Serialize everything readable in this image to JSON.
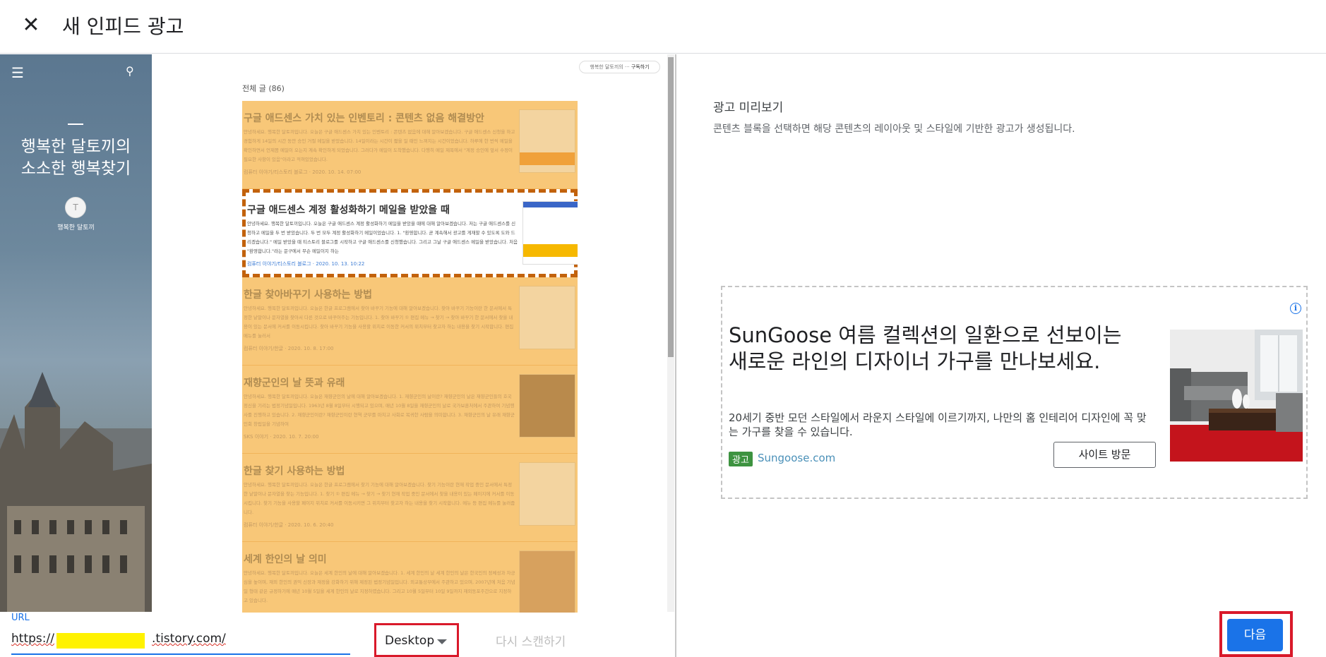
{
  "header": {
    "title": "새 인피드 광고",
    "close_icon": "close-icon"
  },
  "blog": {
    "title_line1": "행복한 달토끼의",
    "title_line2": "소소한 행복찾기",
    "author": "행복한 달토끼",
    "subscribe_owner": "행복한 달토끼의 ···",
    "subscribe_label": "구독하기",
    "total_posts": "전체 글 (86)",
    "posts": [
      {
        "title": "구글 애드센스 가치 있는 인벤토리 : 콘텐츠 없음 해결방안",
        "body": "안녕하세요. 행복한 달토끼입니다. 오늘은 구글 애드센스 가치 있는 인벤토리 : 콘텐츠 없음에 대해 알아보겠습니다. 구글 애드센스 신청을 하고 경험하게 14일의 시간 동안 승인 거절 메일을 받았습니다. 14일이라는 시간이 짧을 일 때인 느껴지는 시간이었습니다. 하루에 한 번씩 메일을 확인하면서 언제쯤 메일이 오는지 계속 확인하게 되었습니다. 그러다가 메일이 도착했습니다. 다행히 메일 제목에서 \"계정 승인에 앞서 수정이 필요한 사항이 있음\"이라고 적혀있었습니다.",
        "meta": "컴퓨터 이야기/티스토리 블로그 · 2020. 10. 14. 07:00"
      },
      {
        "title": "구글 애드센스 계정 활성화하기 메일을 받았을 때",
        "body": "안녕하세요. 행복한 달토끼입니다. 오늘은 구글 애드센스 계정 활성화하기 메일을 받았을 때에 대해 알아보겠습니다. 저는 구글 애드센스를 신청하고 메일을 두 번 받았습니다. 두 번 모두 계정 활성화하기 메일이었습니다. 1. \"환영합니다. 곧 계속해서 광고를 게재할 수 있도록 도와 드리겠습니다.\" 메일 받았을 때 티스토리 블로그를 시작하고 구글 애드센스를 신청했습니다. 그리고 그날 구글 애드센스 메일을 받았습니다. 처음 \"환영합니다.\"라는 문구에서 무슨 메일이지 하는",
        "meta": "컴퓨터 이야기/티스토리 블로그 · 2020. 10. 13. 10:22"
      },
      {
        "title": "한글 찾아바꾸기 사용하는 방법",
        "body": "안녕하세요. 행복한 달토끼입니다. 오늘은 한글 프로그램에서 찾아 바꾸기 기능에 대해 알아보겠습니다. 찾아 바꾸기 기능이란 한 문서에서 특정한 낱말이나 문자열을 찾아서 다른 것으로 바꾸어주는 기능입니다. 1. 찾아 바꾸기 ① 편집 메뉴 → 찾기 → 찾아 바꾸기 한 문서에서 찾을 내용이 있는 문서에 커서를 이동시킵니다. 찾아 바꾸기 기능을 사용할 위치로 이동한 커서의 위치부터 찾고자 하는 내용을 찾기 시작합니다. 편집 메뉴를 눌러서",
        "meta": "컴퓨터 이야기/한글 · 2020. 10. 8. 17:00"
      },
      {
        "title": "재향군인의 날 뜻과 유래",
        "body": "안녕하세요. 행복한 달토끼입니다. 오늘은 재향군인의 날에 대해 알아보겠습니다. 1. 재향군인의 날이란? 재향군인의 날은 재향군인들의 호국정신을 기리는 법정기념일입니다. 1963년 8월 8일부터 시행되고 있으며, 매년 10월 8일을 재향군인의 날로 국가보훈처에서 주관하여 기념행사를 진행하고 있습니다. 2. 재향군인이란? 재향군인이란 현역 군무를 마치고 사회로 복귀한 사람을 의미합니다. 3. 재향군인의 날 유래 재향군인회 창립일을 기념하여",
        "meta": "SKS 이야기 · 2020. 10. 7. 20:00"
      },
      {
        "title": "한글 찾기 사용하는 방법",
        "body": "안녕하세요. 행복한 달토끼입니다. 오늘은 한글 프로그램에서 찾기 기능에 대해 알아보겠습니다. 찾기 기능이란 현재 작업 중인 문서에서 특정한 낱말이나 문자열을 찾는 기능입니다. 1. 찾기 ① 편집 메뉴 → 찾기 → 찾기 현재 작업 중인 문서에서 찾을 내용이 있는 페이지에 커서를 이동시킵니다. 찾기 기능을 사용할 페이지 위치로 커서를 이동시키면 그 위치부터 찾고자 하는 내용을 찾기 시작합니다. 메뉴 등 편집 메뉴를 눌러줍니다.",
        "meta": "컴퓨터 이야기/한글 · 2020. 10. 6. 20:40"
      },
      {
        "title": "세계 한인의 날 의미",
        "body": "안녕하세요. 행복한 달토끼입니다. 오늘은 세계 한인의 날에 대해 알아보겠습니다. 1. 세계 한인의 날 세계 한인의 날은 한국인의 정체성과 자긍심을 높이며, 재외 한인의 권익 신장과 재정을 강화하기 위해 제정된 법정기념일입니다. 외교통상부에서 주관하고 있으며, 2007년에 처음 기념일 형태 같은 규정하기에 매년 10월 5일을 세계 한인의 날로 지정하였습니다. 그리고 10월 5일부터 10일 9일까지 재외동포주간으로 지정하고 있습니다.",
        "meta": ""
      }
    ]
  },
  "url": {
    "label": "URL",
    "prefix": "https://",
    "suffix": ".tistory.com/"
  },
  "device": {
    "selected": "Desktop"
  },
  "rescan_label": "다시 스캔하기",
  "preview": {
    "heading": "광고 미리보기",
    "description": "콘텐츠 블록을 선택하면 해당 콘텐츠의 레이아웃 및 스타일에 기반한 광고가 생성됩니다.",
    "ad": {
      "headline": "SunGoose 여름 컬렉션의 일환으로 선보이는 새로운 라인의 디자이너 가구를 만나보세요.",
      "body": "20세기 중반 모던 스타일에서 라운지 스타일에 이르기까지, 나만의 홈 인테리어 디자인에 꼭 맞는 가구를 찾을 수 있습니다.",
      "badge": "광고",
      "domain": "Sungoose.com",
      "cta": "사이트 방문",
      "info_icon": "i"
    }
  },
  "next_label": "다음"
}
